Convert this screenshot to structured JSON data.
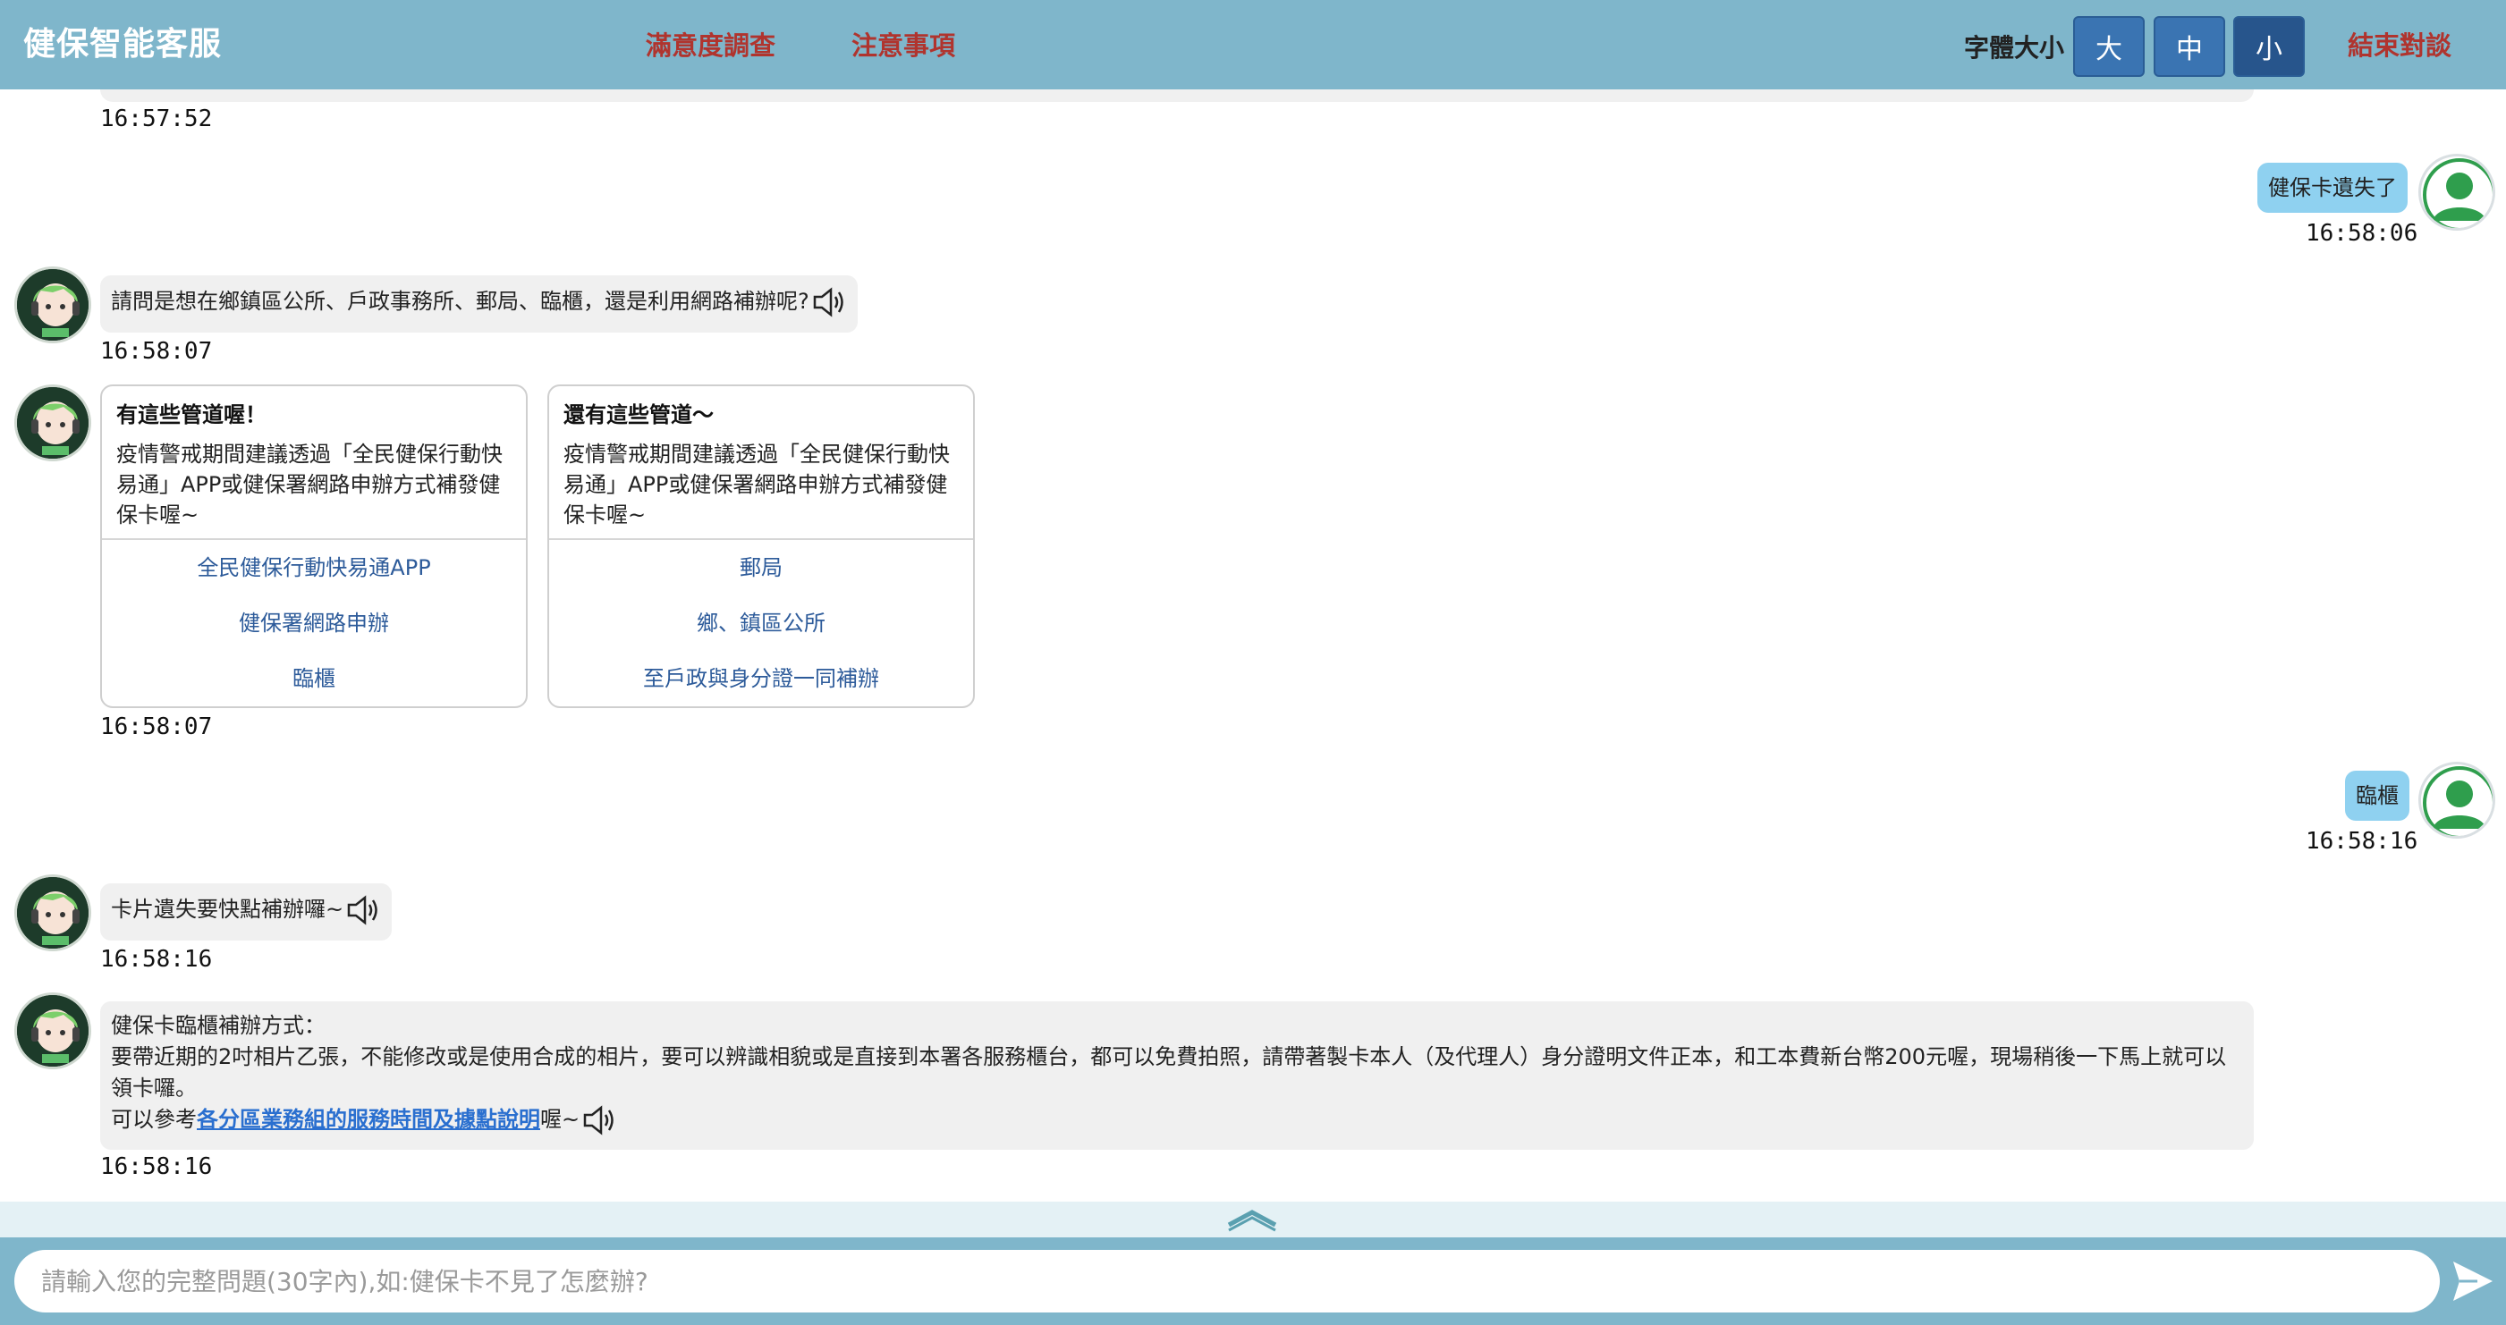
{
  "header": {
    "brand": "健保智能客服",
    "nav_survey": "滿意度調查",
    "nav_notes": "注意事項",
    "font_size_label": "字體大小",
    "font_large": "大",
    "font_medium": "中",
    "font_small": "小",
    "end_chat": "結束對談"
  },
  "messages": {
    "ts0": "16:57:52",
    "user1_text": "健保卡遺失了",
    "user1_ts": "16:58:06",
    "bot1_text": "請問是想在鄉鎮區公所、戶政事務所、郵局、臨櫃，還是利用網路補辦呢?",
    "bot1_ts": "16:58:07",
    "cards_ts": "16:58:07",
    "card1": {
      "title": "有這些管道喔！",
      "text": "疫情警戒期間建議透過「全民健保行動快易通」APP或健保署網路申辦方式補發健保卡喔~",
      "links": [
        "全民健保行動快易通APP",
        "健保署網路申辦",
        "臨櫃"
      ]
    },
    "card2": {
      "title": "還有這些管道～",
      "text": "疫情警戒期間建議透過「全民健保行動快易通」APP或健保署網路申辦方式補發健保卡喔~",
      "links": [
        "郵局",
        "鄉、鎮區公所",
        "至戶政與身分證一同補辦"
      ]
    },
    "user2_text": "臨櫃",
    "user2_ts": "16:58:16",
    "bot2_text": "卡片遺失要快點補辦囉~",
    "bot2_ts": "16:58:16",
    "bot3_line1": "健保卡臨櫃補辦方式：",
    "bot3_line2": "要帶近期的2吋相片乙張，不能修改或是使用合成的相片，要可以辨識相貌或是直接到本署各服務櫃台，都可以免費拍照，請帶著製卡本人（及代理人）身分證明文件正本，和工本費新台幣200元喔，現場稍後一下馬上就可以領卡囉。",
    "bot3_prefix": "可以參考",
    "bot3_link": "各分區業務組的服務時間及據點說明",
    "bot3_suffix": "喔~",
    "bot3_ts": "16:58:16"
  },
  "input": {
    "placeholder": "請輸入您的完整問題(30字內),如:健保卡不見了怎麼辦?"
  },
  "icons": {
    "speaker": "speaker-icon",
    "send": "send-icon",
    "collapse": "chevron-up-icon",
    "bot_avatar": "bot-avatar-icon",
    "user_avatar": "user-avatar-icon"
  },
  "colors": {
    "header_bg": "#7fb6cb",
    "link_red": "#b0342e",
    "user_bubble": "#8fd1f0",
    "bot_bubble": "#f0f0f0",
    "card_link": "#2d5b9a"
  }
}
